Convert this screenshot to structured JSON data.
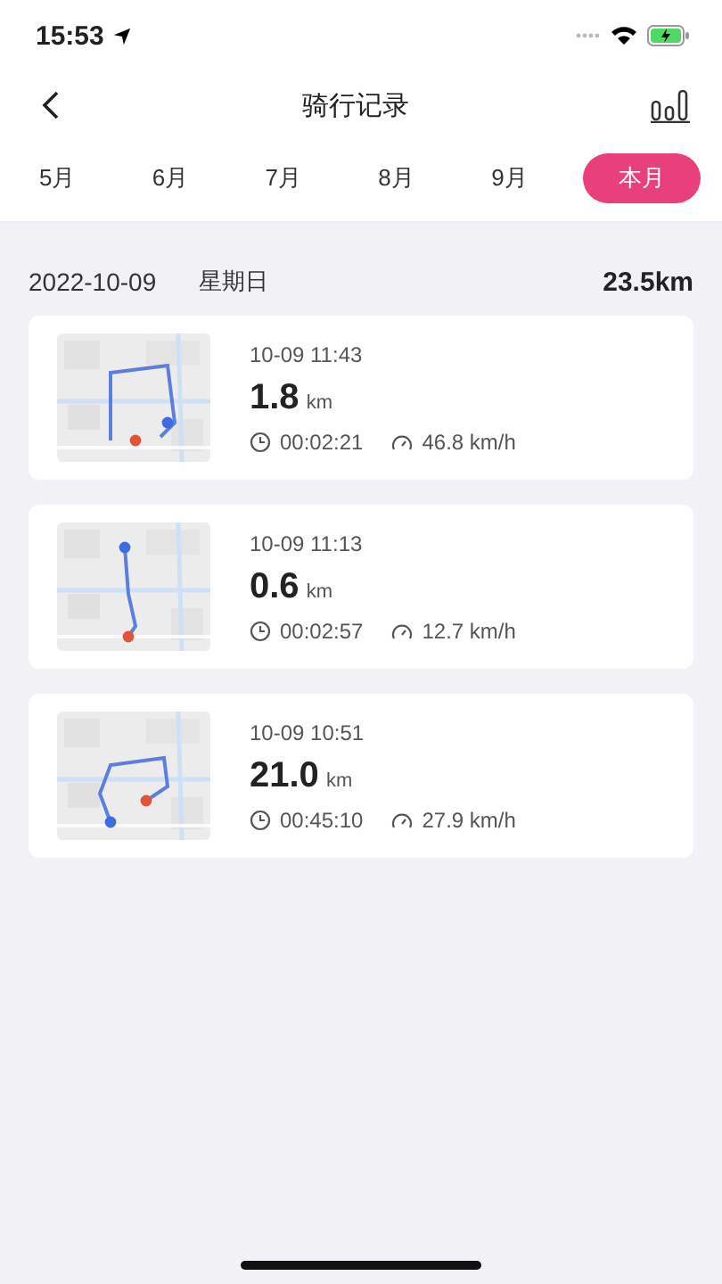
{
  "status_bar": {
    "time": "15:53"
  },
  "header": {
    "title": "骑行记录"
  },
  "tabs": [
    {
      "label": "5月",
      "selected": false
    },
    {
      "label": "6月",
      "selected": false
    },
    {
      "label": "7月",
      "selected": false
    },
    {
      "label": "8月",
      "selected": false
    },
    {
      "label": "9月",
      "selected": false
    },
    {
      "label": "本月",
      "selected": true
    }
  ],
  "day": {
    "date": "2022-10-09",
    "weekday": "星期日",
    "total": "23.5km"
  },
  "rides": [
    {
      "time": "10-09 11:43",
      "distance": "1.8",
      "unit": "km",
      "duration": "00:02:21",
      "speed": "46.8 km/h"
    },
    {
      "time": "10-09 11:13",
      "distance": "0.6",
      "unit": "km",
      "duration": "00:02:57",
      "speed": "12.7 km/h"
    },
    {
      "time": "10-09 10:51",
      "distance": "21.0",
      "unit": "km",
      "duration": "00:45:10",
      "speed": "27.9 km/h"
    }
  ]
}
